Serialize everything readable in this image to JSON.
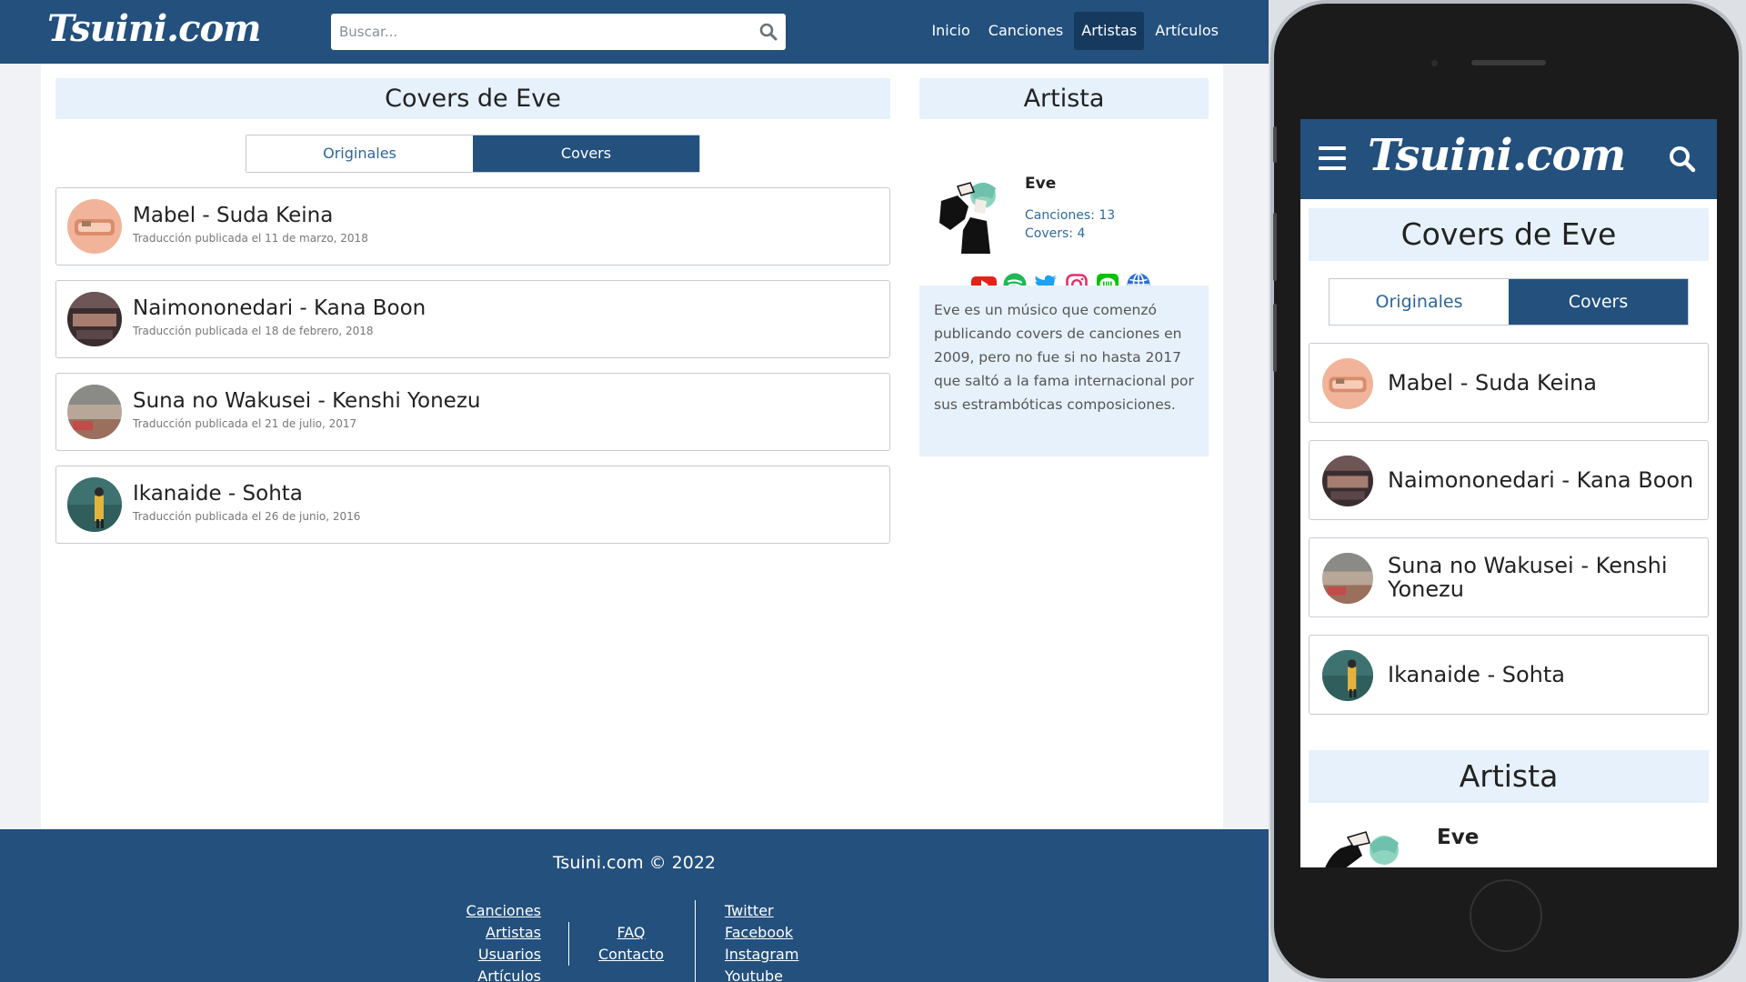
{
  "site": {
    "logo": "Tsuini.com",
    "search_placeholder": "Buscar...",
    "nav": [
      "Inicio",
      "Canciones",
      "Artistas",
      "Artículos"
    ],
    "nav_active_index": 2,
    "accent_color": "#23507d",
    "light_panel_color": "#e6f1fb"
  },
  "main": {
    "title": "Covers de Eve",
    "tabs": [
      "Originales",
      "Covers"
    ],
    "active_tab": 1,
    "songs": [
      {
        "title": "Mabel - Suda Keina",
        "subtitle": "Traducción publicada el 11 de marzo, 2018"
      },
      {
        "title": "Naimononedari - Kana Boon",
        "subtitle": "Traducción publicada el 18 de febrero, 2018"
      },
      {
        "title": "Suna no Wakusei - Kenshi Yonezu",
        "subtitle": "Traducción publicada el 21 de julio, 2017"
      },
      {
        "title": "Ikanaide - Sohta",
        "subtitle": "Traducción publicada el 26 de junio, 2016"
      }
    ]
  },
  "sidebar": {
    "title": "Artista",
    "artist_name": "Eve",
    "songs_count": "Canciones: 13",
    "covers_count": "Covers: 4",
    "social_icons": [
      "youtube-icon",
      "spotify-icon",
      "twitter-icon",
      "instagram-icon",
      "line-icon",
      "website-icon"
    ],
    "bio": "Eve es un músico que comenzó publicando covers de canciones en 2009, pero no fue si no hasta 2017 que saltó a la fama internacional por sus estrambóticas composiciones."
  },
  "footer": {
    "copyright": "Tsuini.com © 2022",
    "col1": [
      "Canciones",
      "Artistas",
      "Usuarios",
      "Artículos"
    ],
    "col2": [
      "FAQ",
      "Contacto"
    ],
    "col3": [
      "Twitter",
      "Facebook",
      "Instagram",
      "Youtube"
    ]
  },
  "mobile": {
    "logo": "Tsuini.com",
    "title": "Covers de Eve",
    "tabs": [
      "Originales",
      "Covers"
    ],
    "songs": [
      "Mabel - Suda Keina",
      "Naimononedari - Kana Boon",
      "Suna no Wakusei - Kenshi Yonezu",
      "Ikanaide - Sohta"
    ],
    "artist_section_title": "Artista",
    "artist_name": "Eve"
  }
}
